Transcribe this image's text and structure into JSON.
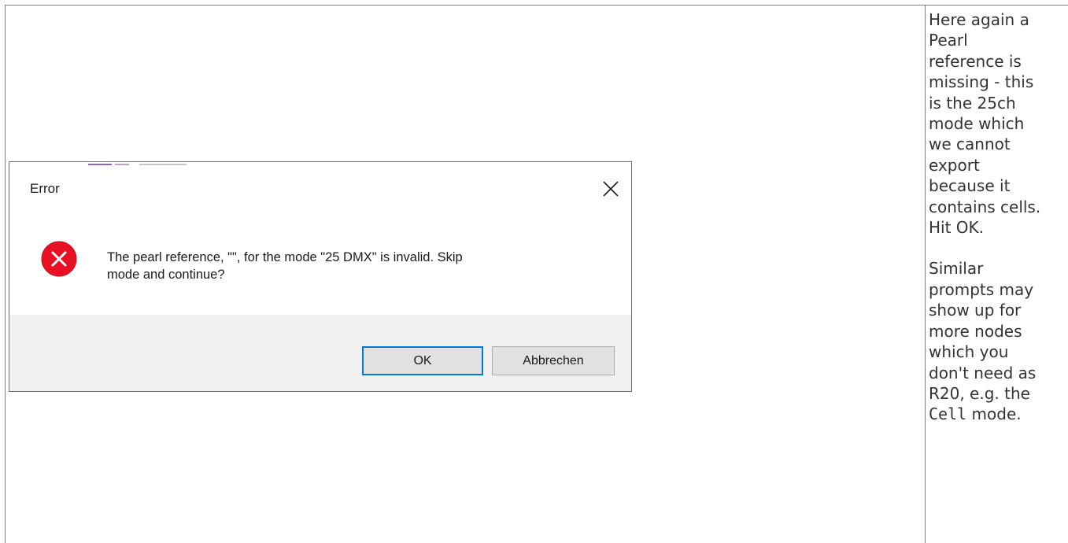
{
  "dialog": {
    "title": "Error",
    "message_line1": "The pearl reference, \"\", for the mode \"25 DMX\" is invalid. Skip",
    "message_line2": "mode and continue?",
    "ok_label": "OK",
    "cancel_label": "Abbrechen",
    "icon": "error-icon",
    "close_icon": "close-icon"
  },
  "notes": {
    "paragraph1_lines": [
      "Here again a",
      "Pearl",
      "reference is",
      "missing - this",
      "is the 25ch",
      "mode which",
      "we cannot",
      "export",
      "because it",
      "contains cells.",
      "Hit OK."
    ],
    "paragraph2_lines": [
      "Similar",
      "prompts may",
      "show up for",
      "more nodes",
      "which you",
      "don't need as",
      "R20, e.g. the"
    ],
    "last_line_code": "Cell",
    "last_line_text": " mode."
  },
  "colors": {
    "ok_focus_border": "#0078d7",
    "error_icon": "#e81123",
    "footer_bg": "#f0f0f0"
  }
}
